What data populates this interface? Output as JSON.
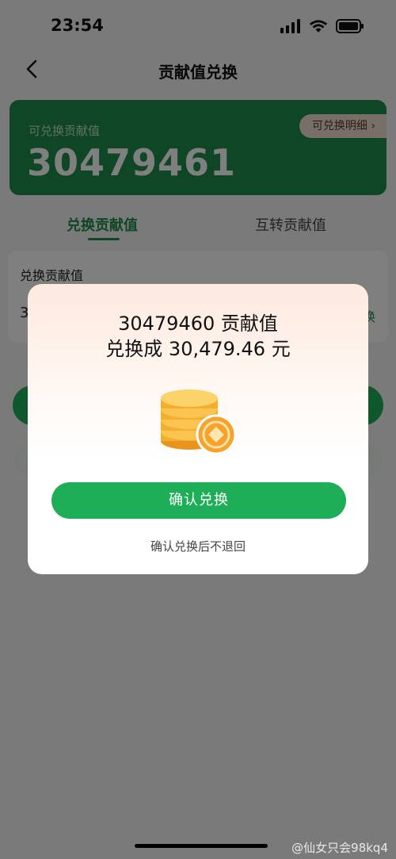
{
  "status_bar": {
    "time": "23:54"
  },
  "nav": {
    "title": "贡献值兑换"
  },
  "balance_card": {
    "label": "可兑换贡献值",
    "value": "30479461",
    "detail_button": "可兑换明细 ›"
  },
  "tabs": [
    {
      "label": "兑换贡献值",
      "active": true
    },
    {
      "label": "互转贡献值",
      "active": false
    }
  ],
  "exchange_panel": {
    "label": "兑换贡献值",
    "input_value": "3",
    "all_text": "换"
  },
  "dialog": {
    "line1": "30479460 贡献值",
    "line2": "兑换成 30,479.46 元",
    "icon": "coin-stack-icon",
    "confirm_button": "确认兑换",
    "note": "确认兑换后不退回"
  },
  "watermark": "@仙女只会98kq4",
  "colors": {
    "brand_green": "#1f8c4b",
    "button_green": "#1fae58",
    "coin_gold": "#f5a623"
  }
}
